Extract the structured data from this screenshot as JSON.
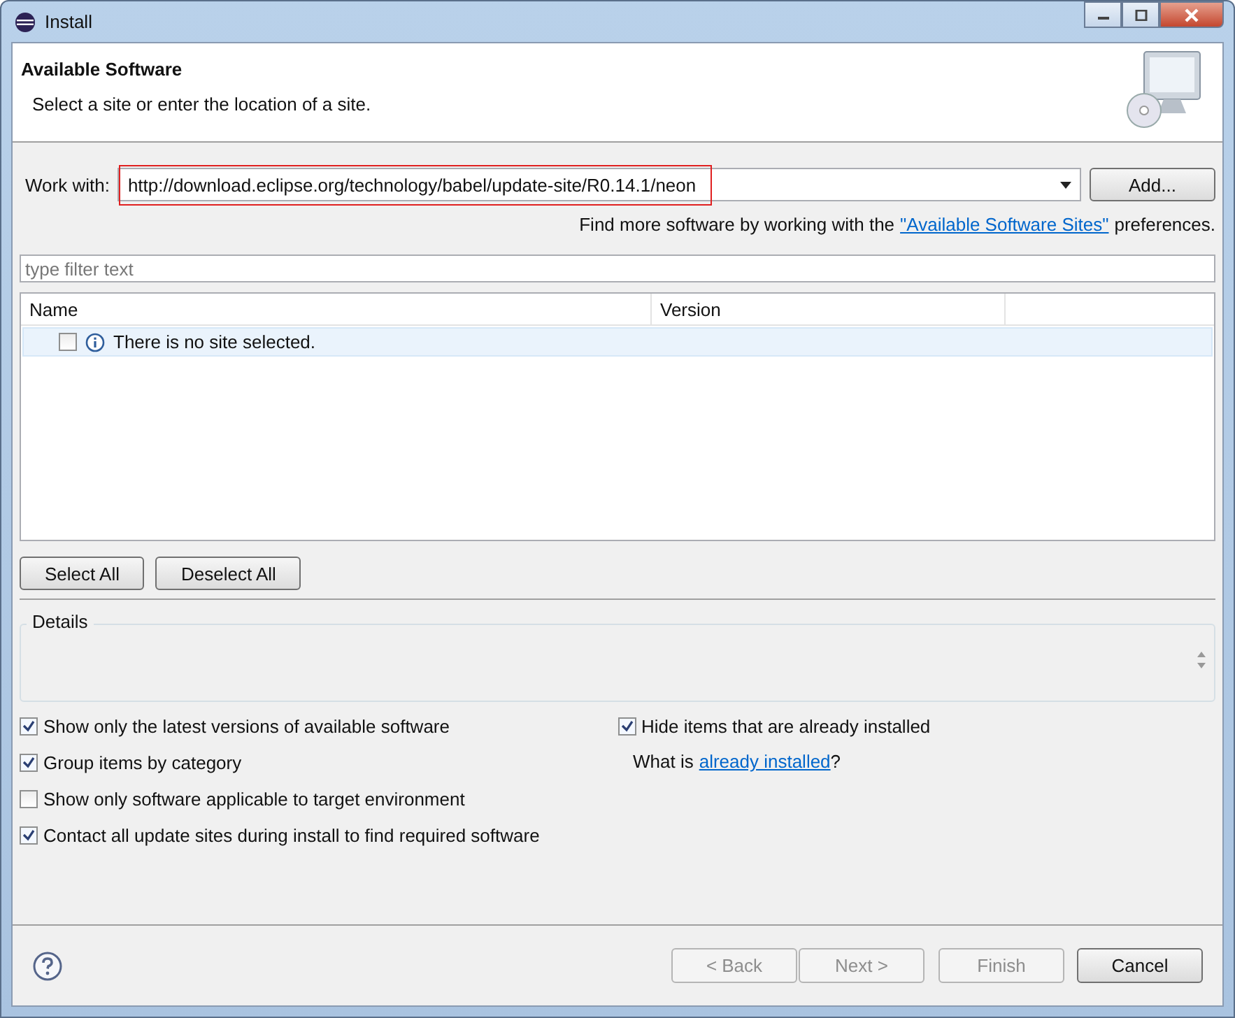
{
  "window": {
    "title": "Install"
  },
  "header": {
    "title": "Available Software",
    "subtitle": "Select a site or enter the location of a site."
  },
  "work_with": {
    "label": "Work with:",
    "value": "http://download.eclipse.org/technology/babel/update-site/R0.14.1/neon",
    "highlighted": true,
    "add_button": "Add..."
  },
  "more_software": {
    "before": "Find more software by working with the",
    "link": "\"Available Software Sites\"",
    "after": "preferences."
  },
  "filter": {
    "placeholder": "type filter text"
  },
  "table": {
    "columns": [
      "Name",
      "Version"
    ],
    "rows": [
      {
        "name": "There is no site selected.",
        "checked": false,
        "selected": true
      }
    ]
  },
  "selection_buttons": [
    "Select All",
    "Deselect All"
  ],
  "details": {
    "label": "Details"
  },
  "options_left": [
    {
      "label": "Show only the latest versions of available software",
      "checked": true
    },
    {
      "label": "Group items by category",
      "checked": true
    },
    {
      "label": "Show only software applicable to target environment",
      "checked": false
    },
    {
      "label": "Contact all update sites during install to find required software",
      "checked": true
    }
  ],
  "options_right": [
    {
      "label": "Hide items that are already installed",
      "checked": true
    }
  ],
  "installed_note": {
    "before": "What is",
    "link": "already installed",
    "after": "?"
  },
  "footer": {
    "buttons": [
      {
        "label": "< Back",
        "disabled": true
      },
      {
        "label": "Next >",
        "disabled": true
      },
      {
        "label": "Finish",
        "disabled": true
      },
      {
        "label": "Cancel",
        "disabled": false
      }
    ]
  }
}
